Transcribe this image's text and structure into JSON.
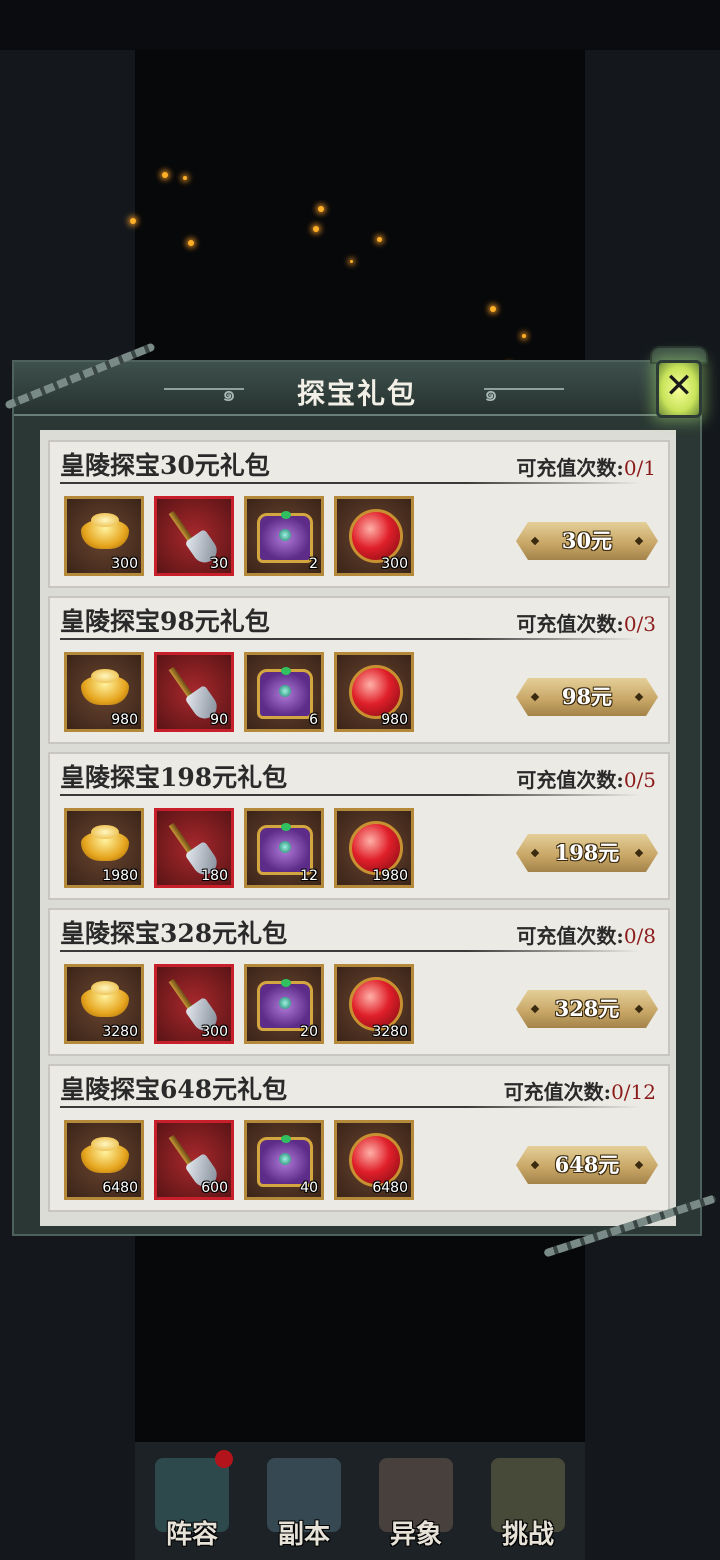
{
  "title": "探宝礼包",
  "close_icon": "close-x-lantern-icon",
  "limit_label": "可充值次数:",
  "packs": [
    {
      "name": "皇陵探宝30元礼包",
      "count": "0/1",
      "price": "30元",
      "items": [
        {
          "icon": "gold-ingot-icon",
          "qty": "300"
        },
        {
          "icon": "shovel-icon",
          "qty": "30"
        },
        {
          "icon": "treasure-chest-icon",
          "qty": "2"
        },
        {
          "icon": "red-orb-icon",
          "qty": "300"
        }
      ]
    },
    {
      "name": "皇陵探宝98元礼包",
      "count": "0/3",
      "price": "98元",
      "items": [
        {
          "icon": "gold-ingot-icon",
          "qty": "980"
        },
        {
          "icon": "shovel-icon",
          "qty": "90"
        },
        {
          "icon": "treasure-chest-icon",
          "qty": "6"
        },
        {
          "icon": "red-orb-icon",
          "qty": "980"
        }
      ]
    },
    {
      "name": "皇陵探宝198元礼包",
      "count": "0/5",
      "price": "198元",
      "items": [
        {
          "icon": "gold-ingot-icon",
          "qty": "1980"
        },
        {
          "icon": "shovel-icon",
          "qty": "180"
        },
        {
          "icon": "treasure-chest-icon",
          "qty": "12"
        },
        {
          "icon": "red-orb-icon",
          "qty": "1980"
        }
      ]
    },
    {
      "name": "皇陵探宝328元礼包",
      "count": "0/8",
      "price": "328元",
      "items": [
        {
          "icon": "gold-ingot-icon",
          "qty": "3280"
        },
        {
          "icon": "shovel-icon",
          "qty": "300"
        },
        {
          "icon": "treasure-chest-icon",
          "qty": "20"
        },
        {
          "icon": "red-orb-icon",
          "qty": "3280"
        }
      ]
    },
    {
      "name": "皇陵探宝648元礼包",
      "count": "0/12",
      "price": "648元",
      "items": [
        {
          "icon": "gold-ingot-icon",
          "qty": "6480"
        },
        {
          "icon": "shovel-icon",
          "qty": "600"
        },
        {
          "icon": "treasure-chest-icon",
          "qty": "40"
        },
        {
          "icon": "red-orb-icon",
          "qty": "6480"
        }
      ]
    }
  ],
  "nav": [
    {
      "label": "阵容",
      "icon": "lineup-icon"
    },
    {
      "label": "副本",
      "icon": "dungeon-icon"
    },
    {
      "label": "异象",
      "icon": "phenomenon-icon"
    },
    {
      "label": "挑战",
      "icon": "challenge-icon"
    }
  ],
  "colors": {
    "count": "#8c1c1c",
    "button_gold": "#c9a868",
    "item_border": "#b48a3a",
    "item_red_border": "#c8202a"
  }
}
